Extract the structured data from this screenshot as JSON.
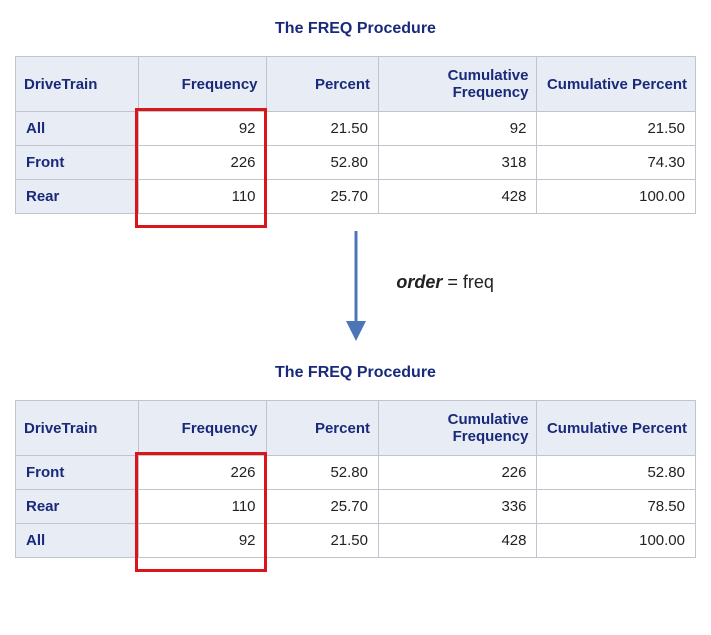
{
  "title": "The FREQ Procedure",
  "headers": {
    "drivetrain": "DriveTrain",
    "frequency": "Frequency",
    "percent": "Percent",
    "cum_freq": "Cumulative Frequency",
    "cum_pct": "Cumulative Percent"
  },
  "table1": {
    "rows": [
      {
        "drivetrain": "All",
        "frequency": "92",
        "percent": "21.50",
        "cum_freq": "92",
        "cum_pct": "21.50"
      },
      {
        "drivetrain": "Front",
        "frequency": "226",
        "percent": "52.80",
        "cum_freq": "318",
        "cum_pct": "74.30"
      },
      {
        "drivetrain": "Rear",
        "frequency": "110",
        "percent": "25.70",
        "cum_freq": "428",
        "cum_pct": "100.00"
      }
    ]
  },
  "table2": {
    "rows": [
      {
        "drivetrain": "Front",
        "frequency": "226",
        "percent": "52.80",
        "cum_freq": "226",
        "cum_pct": "52.80"
      },
      {
        "drivetrain": "Rear",
        "frequency": "110",
        "percent": "25.70",
        "cum_freq": "336",
        "cum_pct": "78.50"
      },
      {
        "drivetrain": "All",
        "frequency": "92",
        "percent": "21.50",
        "cum_freq": "428",
        "cum_pct": "100.00"
      }
    ]
  },
  "annotation": {
    "option_name": "order",
    "equals": " = ",
    "option_value": "freq"
  },
  "chart_data": [
    {
      "type": "table",
      "title": "The FREQ Procedure (default order)",
      "columns": [
        "DriveTrain",
        "Frequency",
        "Percent",
        "Cumulative Frequency",
        "Cumulative Percent"
      ],
      "rows": [
        [
          "All",
          92,
          21.5,
          92,
          21.5
        ],
        [
          "Front",
          226,
          52.8,
          318,
          74.3
        ],
        [
          "Rear",
          110,
          25.7,
          428,
          100.0
        ]
      ]
    },
    {
      "type": "table",
      "title": "The FREQ Procedure (order = freq)",
      "columns": [
        "DriveTrain",
        "Frequency",
        "Percent",
        "Cumulative Frequency",
        "Cumulative Percent"
      ],
      "rows": [
        [
          "Front",
          226,
          52.8,
          226,
          52.8
        ],
        [
          "Rear",
          110,
          25.7,
          336,
          78.5
        ],
        [
          "All",
          92,
          21.5,
          428,
          100.0
        ]
      ]
    }
  ]
}
